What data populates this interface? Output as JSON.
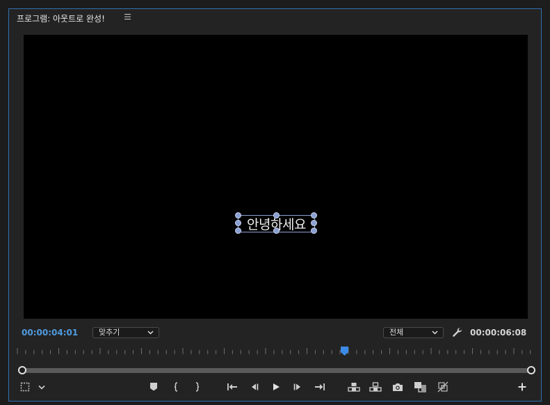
{
  "panel": {
    "title": "프로그램: 아웃트로 완성!",
    "menu_icon": "hamburger-menu-icon"
  },
  "monitor": {
    "caption_text": "안녕하세요"
  },
  "status_bar": {
    "current_timecode": "00:00:04:01",
    "zoom_label": "맞추기",
    "resolution_label": "전체",
    "duration_timecode": "00:00:06:08"
  },
  "controls": [
    "safe-margins-icon",
    "chevron-down-icon",
    "add-marker-icon",
    "mark-in-icon",
    "mark-out-icon",
    "go-to-in-icon",
    "step-back-icon",
    "play-icon",
    "step-forward-icon",
    "go-to-out-icon",
    "lift-icon",
    "extract-icon",
    "export-frame-icon",
    "comparison-view-icon",
    "proxy-toggle-icon",
    "plus-icon"
  ],
  "colors": {
    "accent_blue": "#4f9be0",
    "panel_border": "#2f6fb2",
    "handle_color": "#8aa0d2"
  }
}
